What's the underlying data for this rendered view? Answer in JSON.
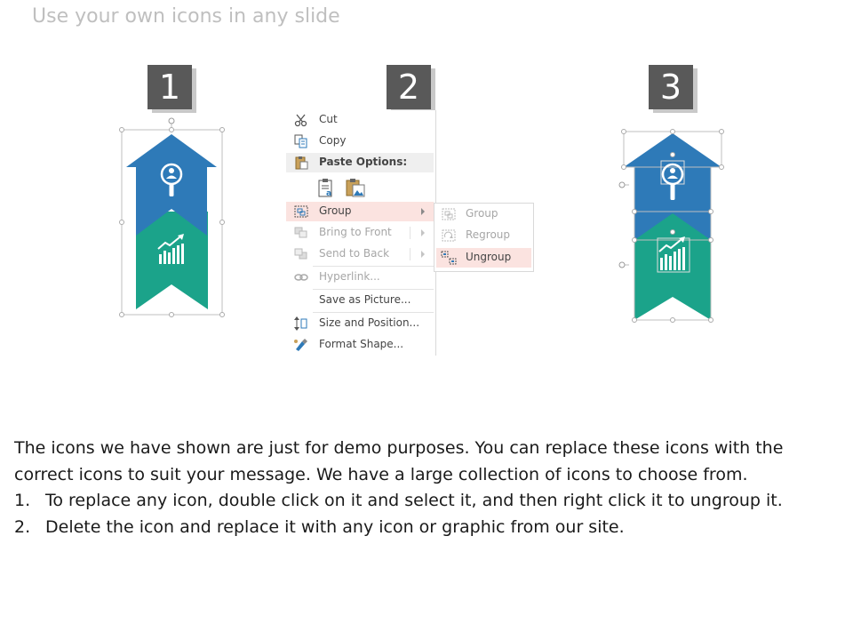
{
  "slide": {
    "title": "Use your own icons in any slide"
  },
  "steps": [
    {
      "number": "1"
    },
    {
      "number": "2"
    },
    {
      "number": "3"
    }
  ],
  "context_menu": {
    "items": [
      {
        "label": "Cut",
        "icon": "scissors-icon",
        "state": "enabled"
      },
      {
        "label": "Copy",
        "icon": "copy-icon",
        "state": "enabled"
      },
      {
        "label": "Paste Options:",
        "icon": "clipboard-icon",
        "state": "header"
      },
      {
        "label": "Group",
        "icon": "group-icon",
        "state": "highlighted",
        "submenu": true
      },
      {
        "label": "Bring to Front",
        "icon": "bring-to-front-icon",
        "state": "disabled",
        "submenu": true
      },
      {
        "label": "Send to Back",
        "icon": "send-to-back-icon",
        "state": "disabled",
        "submenu": true
      },
      {
        "label": "Hyperlink...",
        "icon": "link-icon",
        "state": "disabled"
      },
      {
        "label": "Save as Picture...",
        "icon": "",
        "state": "enabled"
      },
      {
        "label": "Size and Position...",
        "icon": "size-position-icon",
        "state": "enabled"
      },
      {
        "label": "Format Shape...",
        "icon": "format-shape-icon",
        "state": "enabled"
      }
    ],
    "paste_option_icons": [
      "paste-keep-formatting-icon",
      "paste-picture-icon"
    ]
  },
  "group_submenu": {
    "items": [
      {
        "label": "Group",
        "icon": "group-icon",
        "state": "disabled"
      },
      {
        "label": "Regroup",
        "icon": "regroup-icon",
        "state": "disabled"
      },
      {
        "label": "Ungroup",
        "icon": "ungroup-icon",
        "state": "highlighted"
      }
    ]
  },
  "graphic": {
    "top_icon": "search-user-icon",
    "bottom_icon": "bar-chart-growth-icon"
  },
  "colors": {
    "blue": "#2e7ab8",
    "green": "#1ba38a",
    "number_box": "#595959",
    "highlight": "#fbe3e0"
  },
  "body": {
    "paragraph_line1": "The icons we have shown are just for demo purposes. You can replace these icons with the",
    "paragraph_line2": "correct icons to suit your message. We have a large collection of icons to choose from.",
    "list": [
      {
        "num": "1.",
        "text": "To replace any icon, double click on it and select it, and then right click it to ungroup it."
      },
      {
        "num": "2.",
        "text": "Delete the icon and replace it with any icon or graphic from our site."
      }
    ]
  }
}
